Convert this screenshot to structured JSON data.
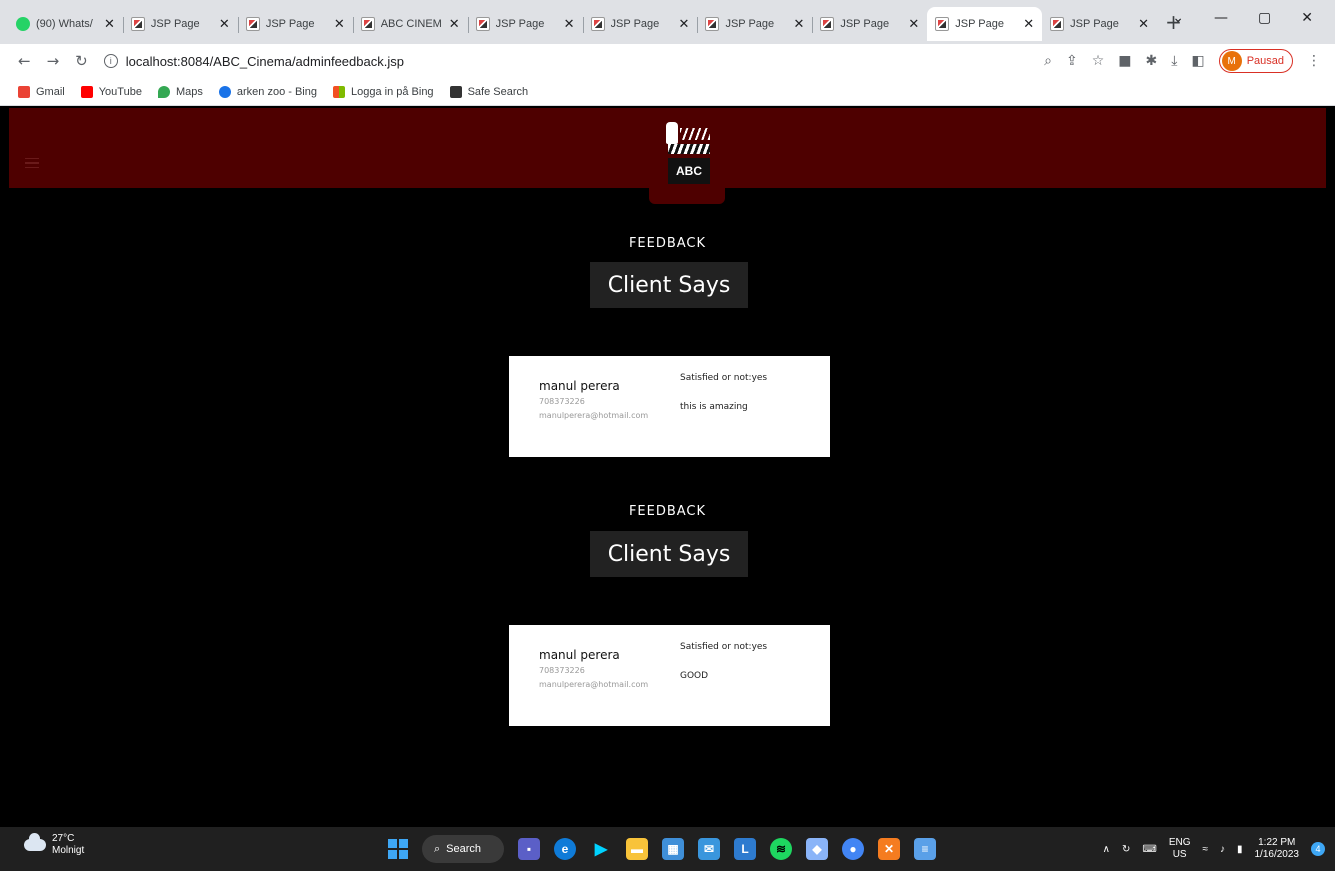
{
  "browser": {
    "tabs": [
      {
        "title": "(90) Whats/",
        "icon": "whatsapp-icon",
        "active": false
      },
      {
        "title": "JSP Page",
        "icon": "page-icon",
        "active": false
      },
      {
        "title": "JSP Page",
        "icon": "page-icon",
        "active": false
      },
      {
        "title": "ABC CINEM",
        "icon": "page-icon",
        "active": false
      },
      {
        "title": "JSP Page",
        "icon": "page-icon",
        "active": false
      },
      {
        "title": "JSP Page",
        "icon": "page-icon",
        "active": false
      },
      {
        "title": "JSP Page",
        "icon": "page-icon",
        "active": false
      },
      {
        "title": "JSP Page",
        "icon": "page-icon",
        "active": false
      },
      {
        "title": "JSP Page",
        "icon": "page-icon",
        "active": true
      },
      {
        "title": "JSP Page",
        "icon": "page-icon",
        "active": false
      }
    ],
    "url": "localhost:8084/ABC_Cinema/adminfeedback.jsp",
    "profile_initial": "M",
    "profile_label": "Pausad",
    "bookmarks": [
      {
        "label": "Gmail",
        "color": "#ea4335"
      },
      {
        "label": "YouTube",
        "color": "#ff0000"
      },
      {
        "label": "Maps",
        "color": "#34a853"
      },
      {
        "label": "arken zoo - Bing",
        "color": "#1a73e8"
      },
      {
        "label": "Logga in på Bing",
        "color": "#f4b400"
      },
      {
        "label": "Safe Search",
        "color": "#333333"
      }
    ]
  },
  "site": {
    "header_color": "#4e0000",
    "logo_text": "ABC",
    "feedback_sections": [
      {
        "kicker": "FEEDBACK",
        "title": "Client Says",
        "card": {
          "name": "manul perera",
          "phone": "708373226",
          "email": "manulperera@hotmail.com",
          "satisfied": "Satisfied or not:yes",
          "message": "this is amazing"
        }
      },
      {
        "kicker": "FEEDBACK",
        "title": "Client Says",
        "card": {
          "name": "manul perera",
          "phone": "708373226",
          "email": "manulperera@hotmail.com",
          "satisfied": "Satisfied or not:yes",
          "message": "GOOD"
        }
      }
    ]
  },
  "taskbar": {
    "weather_temp": "27°C",
    "weather_desc": "Molnigt",
    "search_label": "Search",
    "lang_top": "ENG",
    "lang_bottom": "US",
    "time": "1:22 PM",
    "date": "1/16/2023",
    "notification_count": "4"
  }
}
